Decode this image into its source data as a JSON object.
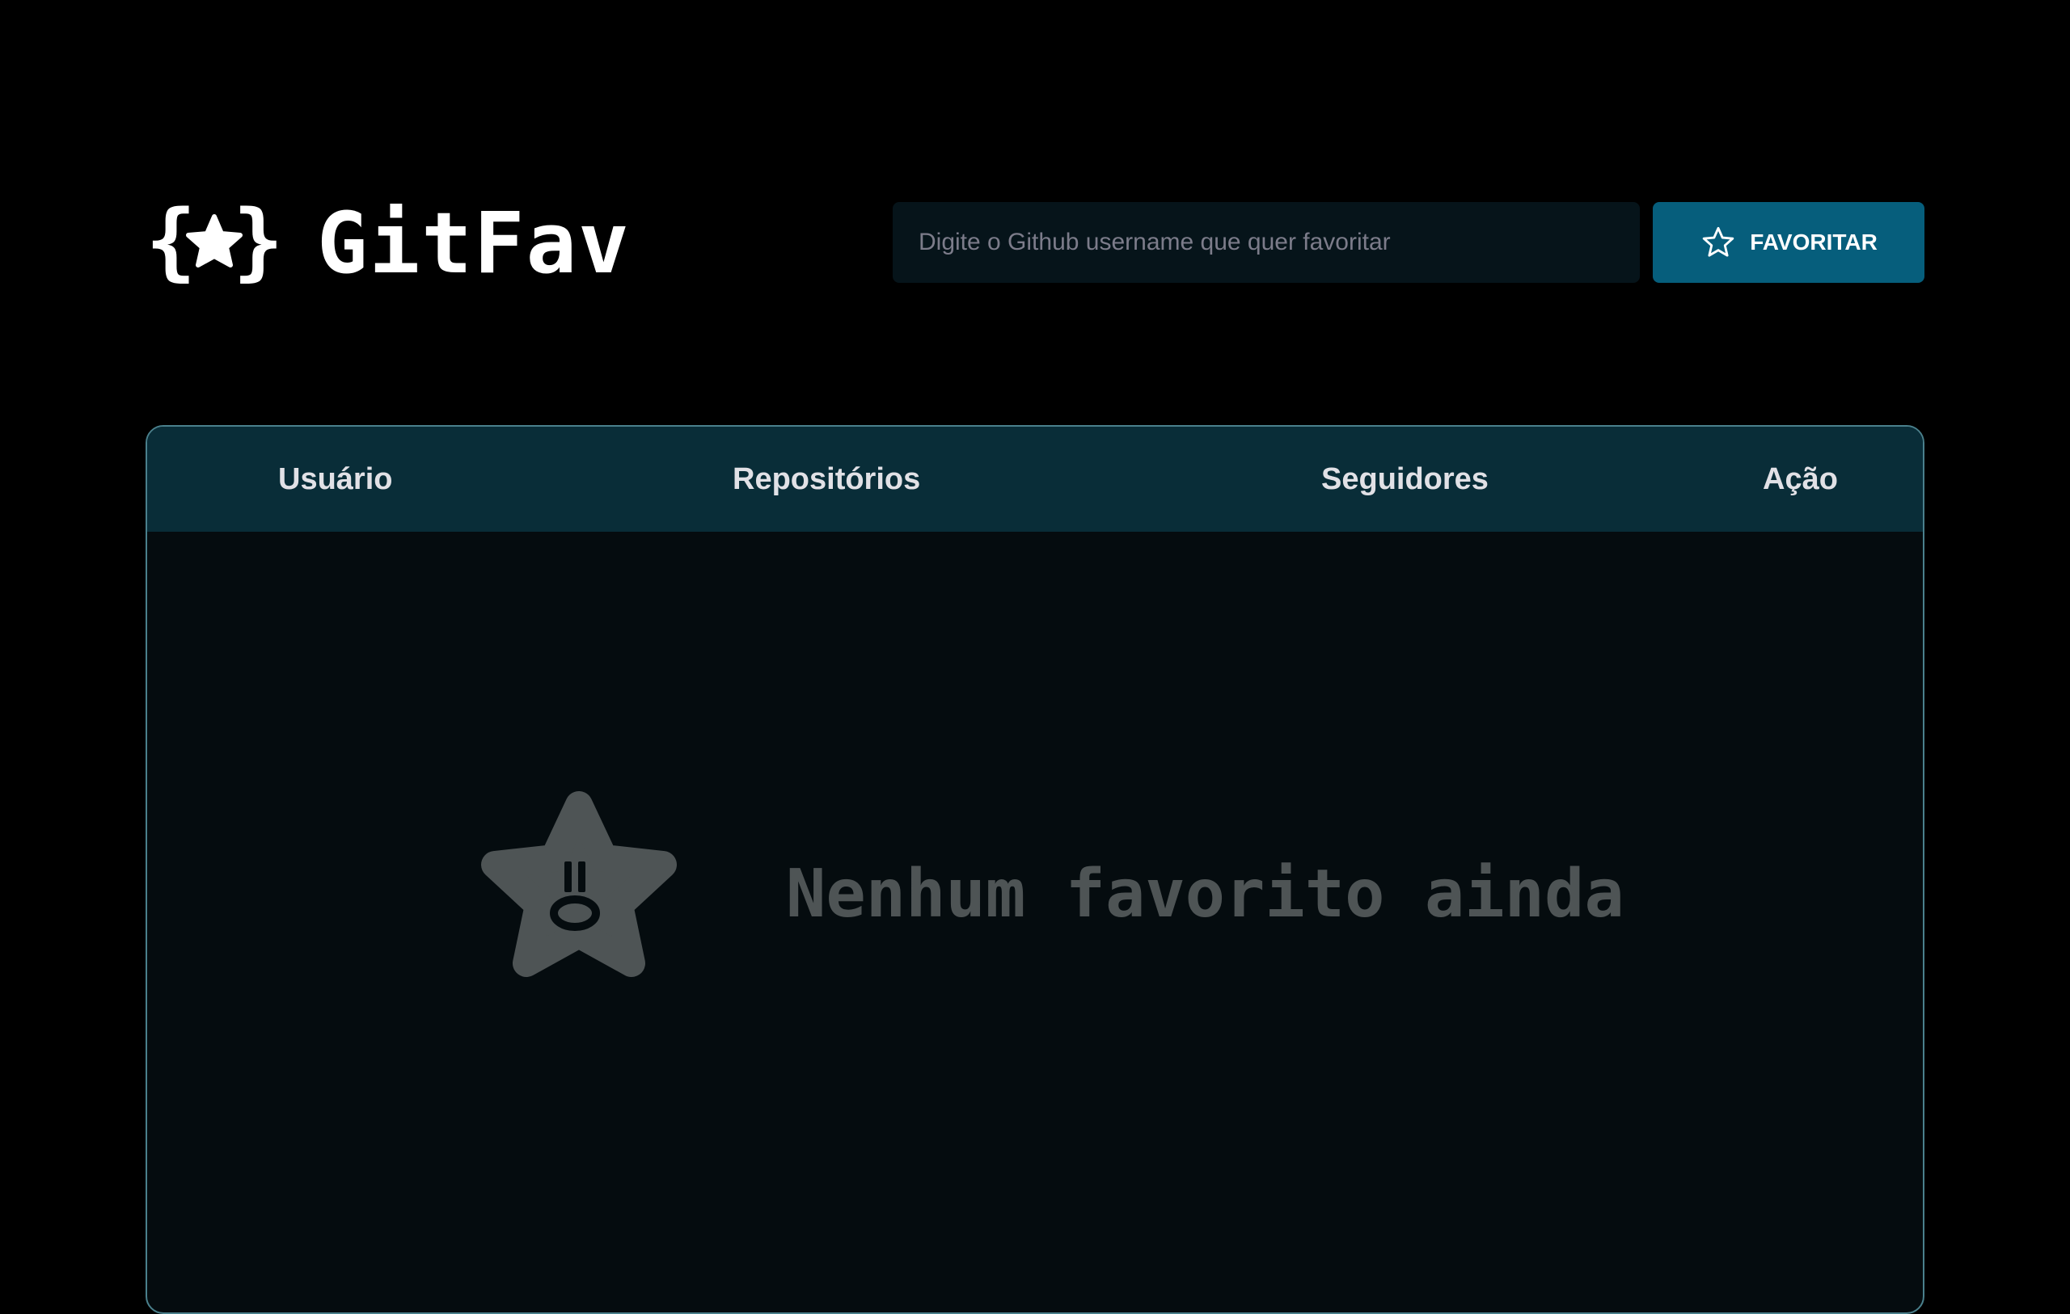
{
  "app": {
    "logo_icon": "braces-star-logo",
    "title": "GitFav"
  },
  "search": {
    "placeholder": "Digite o Github username que quer favoritar",
    "value": ""
  },
  "favorite_button": {
    "icon": "star-outline-icon",
    "label": "FAVORITAR"
  },
  "table": {
    "columns": [
      "Usuário",
      "Repositórios",
      "Seguidores",
      "Ação"
    ],
    "rows": []
  },
  "empty_state": {
    "icon": "sad-star-icon",
    "message": "Nenhum favorito ainda"
  },
  "colors": {
    "background": "#000000",
    "accent": "#065e7c",
    "table_header": "#092d38",
    "table_body": "#050c0f",
    "input_background": "#06141a",
    "muted_text": "#4e5455"
  }
}
